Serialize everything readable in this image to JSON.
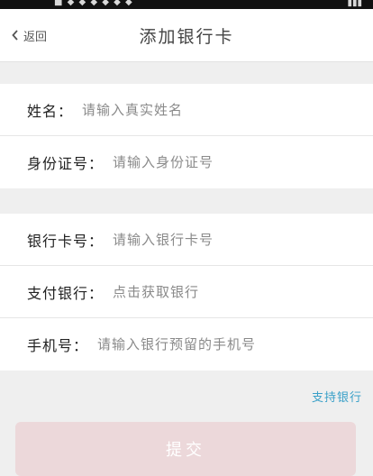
{
  "nav": {
    "back_label": "返回",
    "title": "添加银行卡"
  },
  "form": {
    "personal": [
      {
        "label": "姓名：",
        "placeholder": "请输入真实姓名"
      },
      {
        "label": "身份证号：",
        "placeholder": "请输入身份证号"
      }
    ],
    "bank": [
      {
        "label": "银行卡号：",
        "placeholder": "请输入银行卡号"
      },
      {
        "label": "支付银行：",
        "value": "点击获取银行"
      },
      {
        "label": "手机号：",
        "placeholder": "请输入银行预留的手机号"
      }
    ]
  },
  "supported_banks_label": "支持银行",
  "submit_label": "提交",
  "colors": {
    "link": "#3aa0c8",
    "submit_bg": "#ecd8da"
  }
}
